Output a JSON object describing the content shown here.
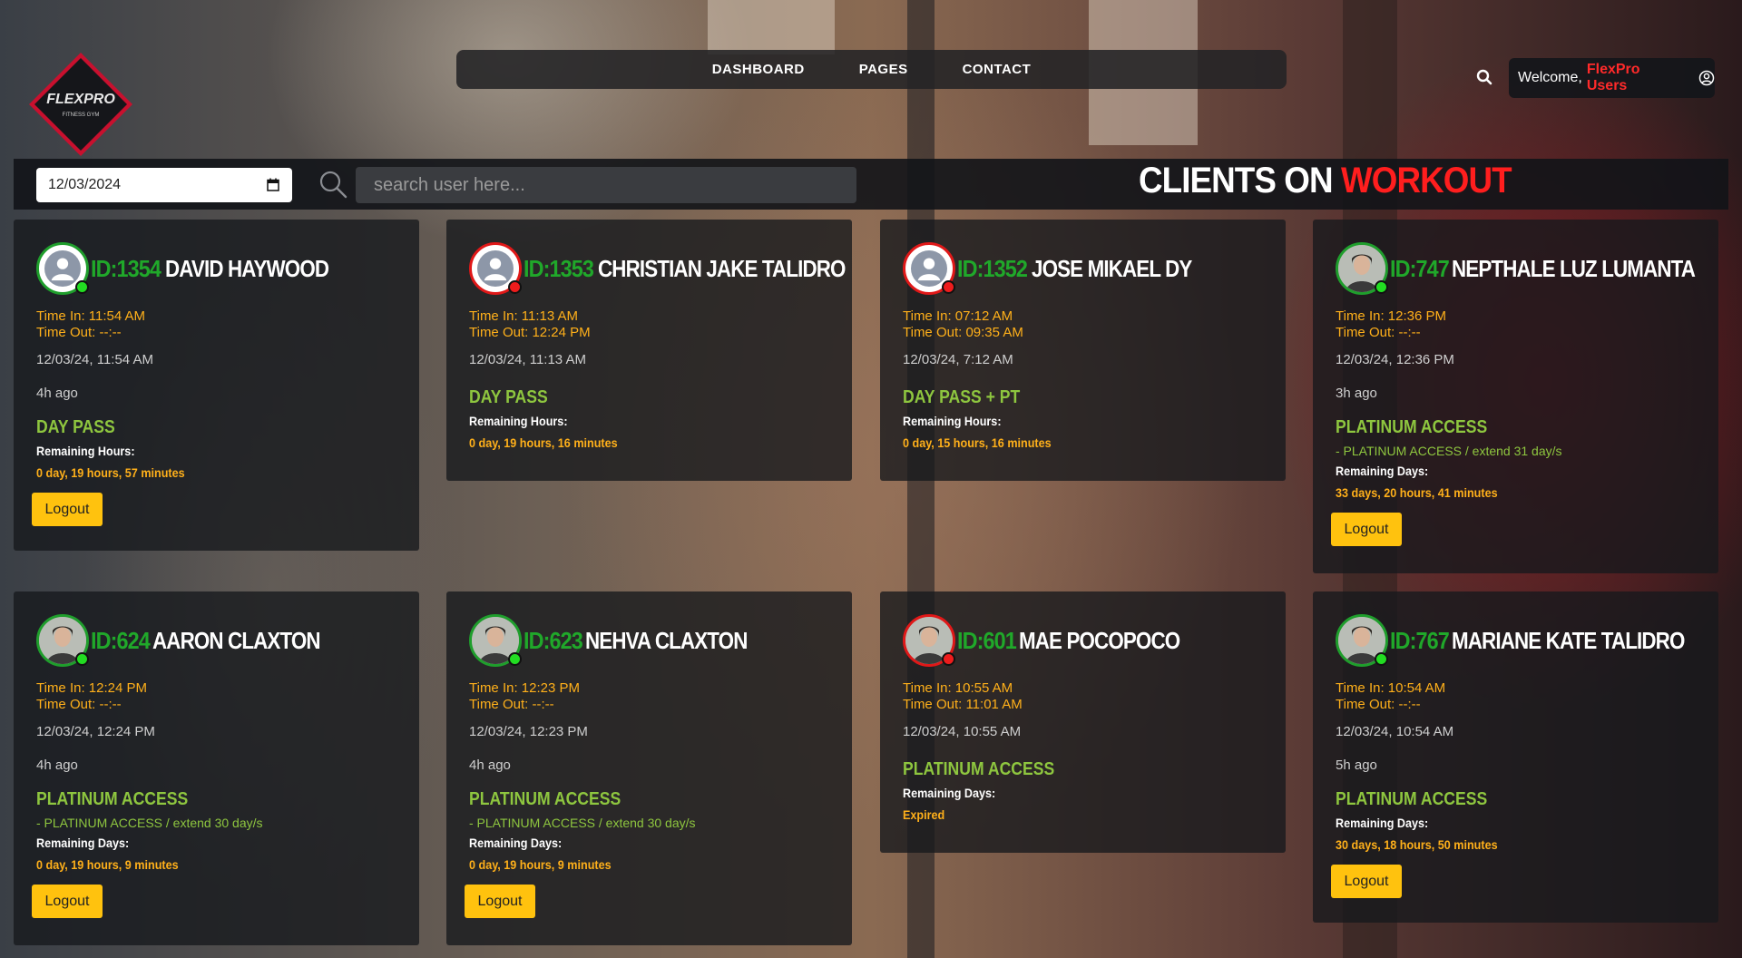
{
  "brand": {
    "logo_text": "FLEXPRO",
    "logo_sub": "FITNESS GYM"
  },
  "nav": {
    "items": [
      "DASHBOARD",
      "PAGES",
      "CONTACT"
    ]
  },
  "header": {
    "welcome_prefix": "Welcome,",
    "user": "FlexPro Users"
  },
  "toolbar": {
    "date_value": "12/03/2024",
    "search_placeholder": "search user here...",
    "title_main": "CLIENTS ON ",
    "title_accent": "WORKOUT"
  },
  "colors": {
    "accent_red": "#ff1e1e",
    "id_green": "#20a82a",
    "plan_green": "#8ec63f",
    "time_orange": "#ffb01a",
    "button_yellow": "#ffc20e"
  },
  "cards": [
    {
      "id": "ID:1354",
      "name": "DAVID HAYWOOD",
      "status": "online",
      "avatar": "placeholder",
      "time_in": "Time In: 11:54 AM",
      "time_out": "Time Out: --:--",
      "date": "12/03/24, 11:54 AM",
      "ago": "4h ago",
      "plan": "DAY PASS",
      "extend": "",
      "remaining_label": "Remaining Hours:",
      "remaining": "0 day, 19 hours, 57 minutes",
      "logout": "Logout"
    },
    {
      "id": "ID:1353",
      "name": "CHRISTIAN JAKE TALIDRO",
      "status": "offline",
      "avatar": "placeholder",
      "time_in": "Time In: 11:13 AM",
      "time_out": "Time Out: 12:24 PM",
      "date": "12/03/24, 11:13 AM",
      "ago": "",
      "plan": "DAY PASS",
      "extend": "",
      "remaining_label": "Remaining Hours:",
      "remaining": "0 day, 19 hours, 16 minutes",
      "logout": ""
    },
    {
      "id": "ID:1352",
      "name": "JOSE MIKAEL DY",
      "status": "offline",
      "avatar": "placeholder",
      "time_in": "Time In: 07:12 AM",
      "time_out": "Time Out: 09:35 AM",
      "date": "12/03/24, 7:12 AM",
      "ago": "",
      "plan": "DAY PASS + PT",
      "extend": "",
      "remaining_label": "Remaining Hours:",
      "remaining": "0 day, 15 hours, 16 minutes",
      "logout": ""
    },
    {
      "id": "ID:747",
      "name": "NEPTHALE LUZ LUMANTA",
      "status": "online",
      "avatar": "photo",
      "time_in": "Time In: 12:36 PM",
      "time_out": "Time Out: --:--",
      "date": "12/03/24, 12:36 PM",
      "ago": "3h ago",
      "plan": "PLATINUM ACCESS",
      "extend": "- PLATINUM ACCESS / extend 31 day/s",
      "remaining_label": "Remaining Days:",
      "remaining": "33 days, 20 hours, 41 minutes",
      "logout": "Logout"
    },
    {
      "id": "ID:624",
      "name": "AARON CLAXTON",
      "status": "online",
      "avatar": "photo",
      "time_in": "Time In: 12:24 PM",
      "time_out": "Time Out: --:--",
      "date": "12/03/24, 12:24 PM",
      "ago": "4h ago",
      "plan": "PLATINUM ACCESS",
      "extend": "- PLATINUM ACCESS / extend 30 day/s",
      "remaining_label": "Remaining Days:",
      "remaining": "0 day, 19 hours, 9 minutes",
      "logout": "Logout"
    },
    {
      "id": "ID:623",
      "name": "NEHVA CLAXTON",
      "status": "online",
      "avatar": "photo",
      "time_in": "Time In: 12:23 PM",
      "time_out": "Time Out: --:--",
      "date": "12/03/24, 12:23 PM",
      "ago": "4h ago",
      "plan": "PLATINUM ACCESS",
      "extend": "- PLATINUM ACCESS / extend 30 day/s",
      "remaining_label": "Remaining Days:",
      "remaining": "0 day, 19 hours, 9 minutes",
      "logout": "Logout"
    },
    {
      "id": "ID:601",
      "name": "MAE POCOPOCO",
      "status": "offline",
      "avatar": "photo",
      "time_in": "Time In: 10:55 AM",
      "time_out": "Time Out: 11:01 AM",
      "date": "12/03/24, 10:55 AM",
      "ago": "",
      "plan": "PLATINUM ACCESS",
      "extend": "",
      "remaining_label": "Remaining Days:",
      "remaining": "Expired",
      "logout": ""
    },
    {
      "id": "ID:767",
      "name": "MARIANE KATE TALIDRO",
      "status": "online",
      "avatar": "photo",
      "time_in": "Time In: 10:54 AM",
      "time_out": "Time Out: --:--",
      "date": "12/03/24, 10:54 AM",
      "ago": "5h ago",
      "plan": "PLATINUM ACCESS",
      "extend": "",
      "remaining_label": "Remaining Days:",
      "remaining": "30 days, 18 hours, 50 minutes",
      "logout": "Logout"
    }
  ]
}
